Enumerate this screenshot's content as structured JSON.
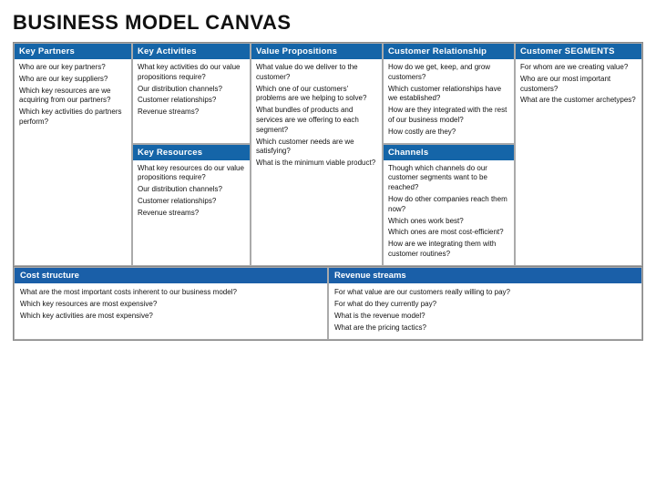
{
  "title": "BUSINESS MODEL CANVAS",
  "cells": {
    "key_partners": {
      "header": "Key Partners",
      "lines": [
        "Who are our key partners?",
        "Who are our key suppliers?",
        "Which key resources are we acquiring from our partners?",
        "Which key activities do partners perform?"
      ]
    },
    "key_activities": {
      "header": "Key Activities",
      "lines": [
        "What key activities do our value propositions require?",
        "Our distribution channels?",
        "Customer relationships?",
        "Revenue streams?"
      ]
    },
    "key_resources": {
      "header": "Key Resources",
      "lines": [
        "What key resources do our value propositions require?",
        "Our distribution channels?",
        "Customer relationships?",
        "Revenue streams?"
      ]
    },
    "value_propositions": {
      "header": "Value Propositions",
      "lines": [
        "What value do we deliver to the customer?",
        "Which one of our customers' problems are we helping to solve?",
        "What bundles of products and services are we offering to each segment?",
        "Which customer needs are we satisfying?",
        "What is the minimum viable product?"
      ]
    },
    "customer_relationship": {
      "header": "Customer Relationship",
      "lines": [
        "How do we get, keep, and grow customers?",
        "Which customer relationships have we established?",
        "How are they integrated with the rest of our business model?",
        "How costly are they?"
      ]
    },
    "channels": {
      "header": "Channels",
      "lines": [
        "Though which channels do our customer segments want to be reached?",
        "How do other companies reach them now?",
        "Which ones work best?",
        "Which ones are most cost-efficient?",
        "How are we integrating them with customer routines?"
      ]
    },
    "customer_segments": {
      "header": "Customer SEGMENTS",
      "lines": [
        "For whom are we creating value?",
        "Who are our most important customers?",
        "What are the customer archetypes?"
      ]
    },
    "cost_structure": {
      "header": "Cost structure",
      "lines": [
        "What are the most important costs inherent to our business model?",
        "Which key resources are most expensive?",
        "Which key activities are most expensive?"
      ]
    },
    "revenue_streams": {
      "header": "Revenue streams",
      "lines": [
        "For what value are our customers really willing to pay?",
        "For what do they currently pay?",
        "What is the revenue model?",
        "What are the pricing tactics?"
      ]
    }
  }
}
